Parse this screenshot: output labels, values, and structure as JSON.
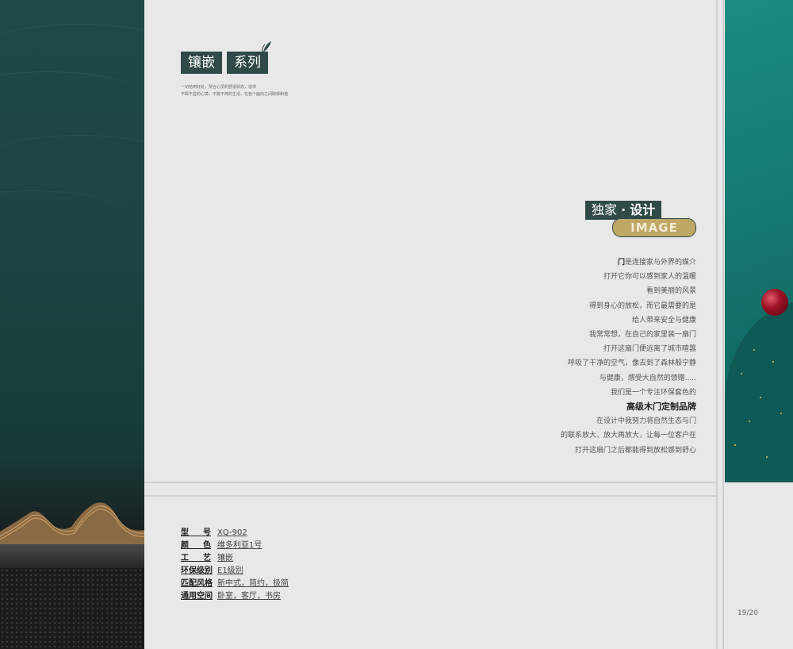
{
  "logo": {
    "part1": "镶嵌",
    "part2": "系列"
  },
  "tagline": {
    "line1": "一切恰到好处，契合心灵的舒适状态，追求",
    "line2": "不羁不显的心境，不繁不简的生活，在各个面向之间取得和谐"
  },
  "badge": {
    "cn_part1": "独家",
    "dot": "·",
    "cn_part2": "设计",
    "en": "IMAGE"
  },
  "poem": [
    {
      "strong": "门",
      "text": "是连接家与外界的媒介"
    },
    {
      "text": "打开它你可以感到家人的温暖"
    },
    {
      "text": "看到美丽的风景"
    },
    {
      "text": "得到身心的放松，而它最需要的是"
    },
    {
      "text": "给人带来安全与健康"
    },
    {
      "text": "我常常想，在自己的家里装一扇门"
    },
    {
      "text": "打开这扇门便远离了城市喧嚣"
    },
    {
      "text": "呼吸了干净的空气，像去到了森林般宁静"
    },
    {
      "text": "与健康，感受大自然的馈赠....."
    },
    {
      "text": "我们是一个专注环保套色的"
    },
    {
      "text": "高级木门定制品牌",
      "bold": true
    },
    {
      "text": "在设计中我努力将自然生态与门"
    },
    {
      "text": "的联系放大、放大再放大，让每一位客户在"
    },
    {
      "text": "打开这扇门之后都能得到放松感到舒心"
    }
  ],
  "specs": [
    {
      "key": "型号",
      "value": "XQ-902"
    },
    {
      "key": "颜色",
      "value": "维多利亚1号"
    },
    {
      "key": "工艺",
      "value": "镶嵌"
    },
    {
      "key": "环保级别",
      "value": "E1级别"
    },
    {
      "key": "匹配风格",
      "value": "新中式，简约，极简"
    },
    {
      "key": "通用空间",
      "value": "卧室，客厅，书房"
    }
  ],
  "page_number": "19/20",
  "colors": {
    "brand_dark": "#2f4a48",
    "gold": "#bfa766",
    "teal": "#14766f",
    "ruby": "#a01226"
  }
}
